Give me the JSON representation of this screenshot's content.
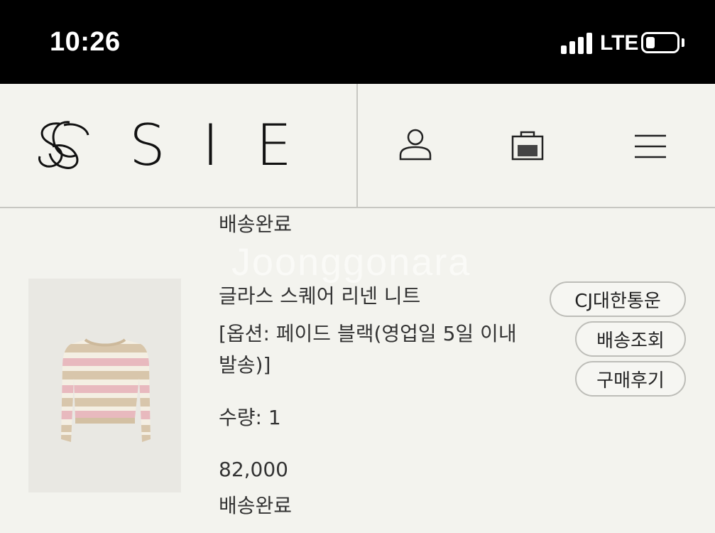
{
  "status_bar": {
    "time": "10:26",
    "network": "LTE",
    "signal_bars": 4,
    "battery_level": 0.3
  },
  "header": {
    "logo_text": "SIE",
    "icons": [
      "user-icon",
      "shopping-bag-icon",
      "hamburger-menu-icon"
    ]
  },
  "watermark": "Joonggonara",
  "order": {
    "status_top": "배송완료",
    "product_name": "글라스 스퀘어 리넨 니트",
    "option_text": "[옵션: 페이드 블랙(영업일 5일 이내 발송)]",
    "quantity": "수량: 1",
    "price": "82,000",
    "status_bottom": "배송완료",
    "buttons": {
      "carrier": "CJ대한통운",
      "tracking": "배송조회",
      "review": "구매후기"
    }
  },
  "colors": {
    "background": "#f3f3ee",
    "status_bar": "#000000",
    "border": "#c7c7c2",
    "text": "#222222",
    "sweater_beige": "#d9c7ad",
    "sweater_pink": "#e8b9be",
    "sweater_cream": "#f6f1e6"
  }
}
